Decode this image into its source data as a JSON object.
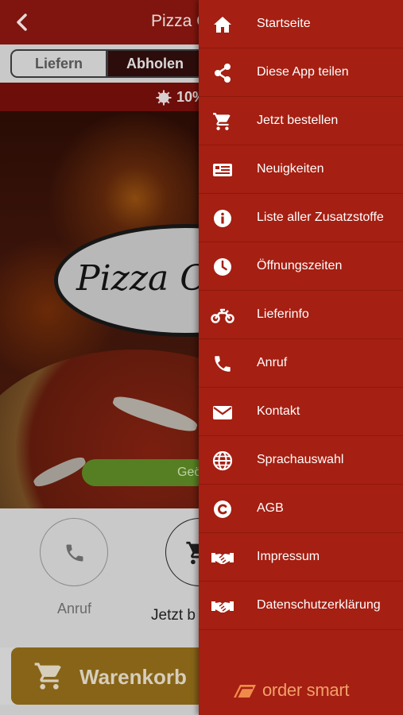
{
  "header": {
    "title": "Pizza C"
  },
  "segment": {
    "delivery_label": "Liefern",
    "pickup_label": "Abholen"
  },
  "promo": {
    "text": "10%"
  },
  "hero": {
    "logo_text": "Pizza C",
    "status_pill": "Geö"
  },
  "actions": {
    "call_label": "Anruf",
    "order_label": "Jetzt b"
  },
  "cart": {
    "label": "Warenkorb"
  },
  "drawer": {
    "items": [
      {
        "label": "Startseite",
        "icon": "home-icon"
      },
      {
        "label": "Diese App teilen",
        "icon": "share-icon"
      },
      {
        "label": "Jetzt bestellen",
        "icon": "cart-icon"
      },
      {
        "label": "Neuigkeiten",
        "icon": "news-icon"
      },
      {
        "label": "Liste aller Zusatzstoffe",
        "icon": "info-icon"
      },
      {
        "label": "Öffnungszeiten",
        "icon": "clock-icon"
      },
      {
        "label": "Lieferinfo",
        "icon": "motorbike-icon"
      },
      {
        "label": "Anruf",
        "icon": "phone-icon"
      },
      {
        "label": "Kontakt",
        "icon": "mail-icon"
      },
      {
        "label": "Sprachauswahl",
        "icon": "globe-icon"
      },
      {
        "label": "AGB",
        "icon": "copyright-icon"
      },
      {
        "label": "Impressum",
        "icon": "handshake-icon"
      },
      {
        "label": "Datenschutzerklärung",
        "icon": "handshake-icon"
      }
    ],
    "brand": "order smart"
  },
  "colors": {
    "drawer_bg": "#a51f12",
    "topbar_bg": "#7f150e",
    "brand_orange": "#f2a06a",
    "cart_bar": "#876417"
  }
}
